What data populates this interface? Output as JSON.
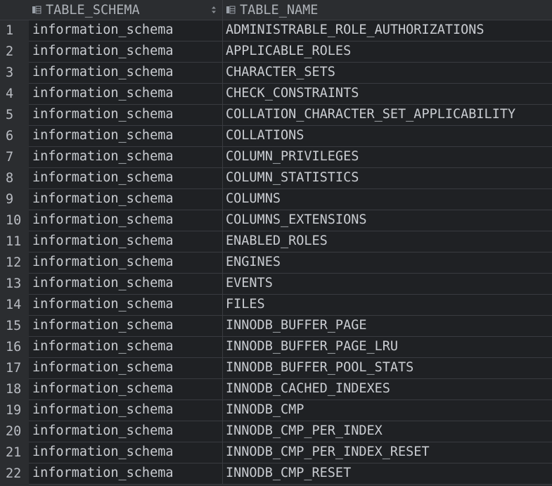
{
  "columns": [
    {
      "label": "TABLE_SCHEMA",
      "icon": "column-icon",
      "sort_icon": "sort-arrows-icon"
    },
    {
      "label": "TABLE_NAME",
      "icon": "column-icon"
    }
  ],
  "rows": [
    {
      "num": "1",
      "schema": "information_schema",
      "name": "ADMINISTRABLE_ROLE_AUTHORIZATIONS"
    },
    {
      "num": "2",
      "schema": "information_schema",
      "name": "APPLICABLE_ROLES"
    },
    {
      "num": "3",
      "schema": "information_schema",
      "name": "CHARACTER_SETS"
    },
    {
      "num": "4",
      "schema": "information_schema",
      "name": "CHECK_CONSTRAINTS"
    },
    {
      "num": "5",
      "schema": "information_schema",
      "name": "COLLATION_CHARACTER_SET_APPLICABILITY"
    },
    {
      "num": "6",
      "schema": "information_schema",
      "name": "COLLATIONS"
    },
    {
      "num": "7",
      "schema": "information_schema",
      "name": "COLUMN_PRIVILEGES"
    },
    {
      "num": "8",
      "schema": "information_schema",
      "name": "COLUMN_STATISTICS"
    },
    {
      "num": "9",
      "schema": "information_schema",
      "name": "COLUMNS"
    },
    {
      "num": "10",
      "schema": "information_schema",
      "name": "COLUMNS_EXTENSIONS"
    },
    {
      "num": "11",
      "schema": "information_schema",
      "name": "ENABLED_ROLES"
    },
    {
      "num": "12",
      "schema": "information_schema",
      "name": "ENGINES"
    },
    {
      "num": "13",
      "schema": "information_schema",
      "name": "EVENTS"
    },
    {
      "num": "14",
      "schema": "information_schema",
      "name": "FILES"
    },
    {
      "num": "15",
      "schema": "information_schema",
      "name": "INNODB_BUFFER_PAGE"
    },
    {
      "num": "16",
      "schema": "information_schema",
      "name": "INNODB_BUFFER_PAGE_LRU"
    },
    {
      "num": "17",
      "schema": "information_schema",
      "name": "INNODB_BUFFER_POOL_STATS"
    },
    {
      "num": "18",
      "schema": "information_schema",
      "name": "INNODB_CACHED_INDEXES"
    },
    {
      "num": "19",
      "schema": "information_schema",
      "name": "INNODB_CMP"
    },
    {
      "num": "20",
      "schema": "information_schema",
      "name": "INNODB_CMP_PER_INDEX"
    },
    {
      "num": "21",
      "schema": "information_schema",
      "name": "INNODB_CMP_PER_INDEX_RESET"
    },
    {
      "num": "22",
      "schema": "information_schema",
      "name": "INNODB_CMP_RESET"
    }
  ],
  "colors": {
    "background": "#2b2d30",
    "cell_background": "#1f2124",
    "grid_line": "#393b40",
    "text": "#c9ccd1"
  }
}
